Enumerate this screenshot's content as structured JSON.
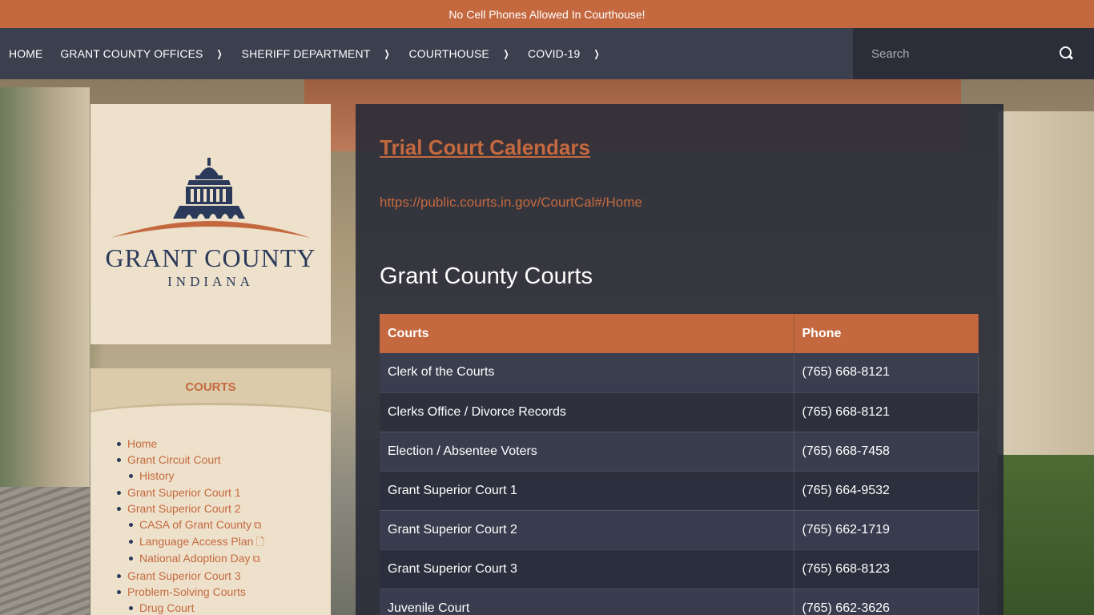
{
  "alert": {
    "text": "No Cell Phones Allowed In Courthouse!"
  },
  "nav": {
    "items": [
      {
        "label": "HOME",
        "has_submenu": false
      },
      {
        "label": "GRANT COUNTY OFFICES",
        "has_submenu": true
      },
      {
        "label": "SHERIFF DEPARTMENT",
        "has_submenu": true
      },
      {
        "label": "COURTHOUSE",
        "has_submenu": true
      },
      {
        "label": "COVID-19",
        "has_submenu": true
      }
    ],
    "search_placeholder": "Search",
    "search_icon": "search-icon"
  },
  "logo": {
    "line1": "GRANT COUNTY",
    "line2": "INDIANA",
    "colors": {
      "navy": "#2b3a5a",
      "orange": "#c4693f"
    }
  },
  "sidebar": {
    "title": "COURTS",
    "items": [
      {
        "label": "Home",
        "level": 1
      },
      {
        "label": "Grant Circuit Court",
        "level": 1
      },
      {
        "label": "History",
        "level": 2
      },
      {
        "label": "Grant Superior Court 1",
        "level": 1
      },
      {
        "label": "Grant Superior Court 2",
        "level": 1
      },
      {
        "label": "CASA of Grant County",
        "level": 2,
        "icon": "external-link-icon"
      },
      {
        "label": "Language Access Plan",
        "level": 2,
        "icon": "document-icon"
      },
      {
        "label": "National Adoption Day",
        "level": 2,
        "icon": "external-link-icon"
      },
      {
        "label": "Grant Superior Court 3",
        "level": 1
      },
      {
        "label": "Problem-Solving Courts",
        "level": 1
      },
      {
        "label": "Drug Court",
        "level": 2
      }
    ]
  },
  "main": {
    "title": "Trial Court Calendars",
    "link": "https://public.courts.in.gov/CourtCal#/Home",
    "section_title": "Grant County Courts",
    "table": {
      "headers": [
        "Courts",
        "Phone"
      ],
      "rows": [
        [
          "Clerk of the Courts",
          "(765) 668-8121"
        ],
        [
          "Clerks Office / Divorce Records",
          "(765) 668-8121"
        ],
        [
          "Election / Absentee Voters",
          "(765) 668-7458"
        ],
        [
          "Grant Superior Court 1",
          "(765) 664-9532"
        ],
        [
          "Grant Superior Court 2",
          "(765) 662-1719"
        ],
        [
          "Grant Superior Court 3",
          "(765) 668-8123"
        ],
        [
          "Juvenile Court",
          "(765) 662-3626"
        ]
      ]
    }
  },
  "colors": {
    "accent": "#c4693f",
    "nav_bg": "#3b3f4e",
    "panel_bg": "#252836"
  }
}
